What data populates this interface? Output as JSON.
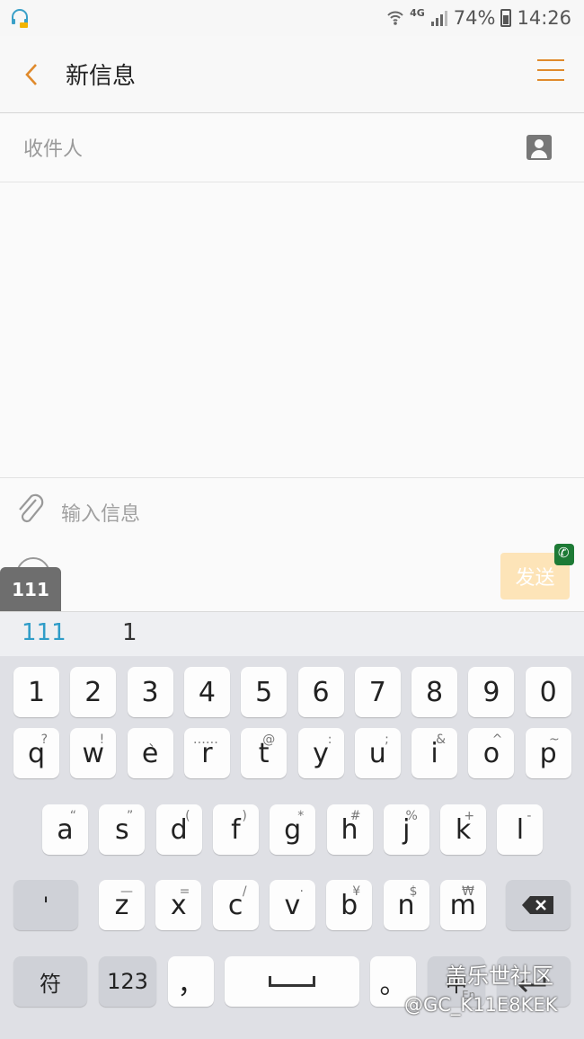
{
  "status_bar": {
    "network": "4G",
    "battery": "74%",
    "time": "14:26"
  },
  "header": {
    "title": "新信息"
  },
  "recipient": {
    "placeholder": "收件人"
  },
  "compose": {
    "placeholder": "输入信息",
    "send_label": "发送",
    "popup_text": "111"
  },
  "candidates": [
    "111",
    "1"
  ],
  "keyboard": {
    "row1": [
      "1",
      "2",
      "3",
      "4",
      "5",
      "6",
      "7",
      "8",
      "9",
      "0"
    ],
    "row2": [
      {
        "main": "q",
        "sub": "?"
      },
      {
        "main": "w",
        "sub": "!"
      },
      {
        "main": "e",
        "sub": "、"
      },
      {
        "main": "r",
        "sub": "……"
      },
      {
        "main": "t",
        "sub": "@"
      },
      {
        "main": "y",
        "sub": ":"
      },
      {
        "main": "u",
        "sub": ";"
      },
      {
        "main": "i",
        "sub": "&"
      },
      {
        "main": "o",
        "sub": "^"
      },
      {
        "main": "p",
        "sub": "~"
      }
    ],
    "row3": [
      {
        "main": "a",
        "sub": "“"
      },
      {
        "main": "s",
        "sub": "”"
      },
      {
        "main": "d",
        "sub": "("
      },
      {
        "main": "f",
        "sub": ")"
      },
      {
        "main": "g",
        "sub": "*"
      },
      {
        "main": "h",
        "sub": "#"
      },
      {
        "main": "j",
        "sub": "%"
      },
      {
        "main": "k",
        "sub": "+"
      },
      {
        "main": "l",
        "sub": "-"
      }
    ],
    "row4": [
      {
        "main": "z",
        "sub": "—"
      },
      {
        "main": "x",
        "sub": "="
      },
      {
        "main": "c",
        "sub": "/"
      },
      {
        "main": "v",
        "sub": "·"
      },
      {
        "main": "b",
        "sub": "¥"
      },
      {
        "main": "n",
        "sub": "$"
      },
      {
        "main": "m",
        "sub": "₩"
      }
    ],
    "apostrophe": "'",
    "symbols_label": "符",
    "numbers_label": "123",
    "comma_label": "，",
    "period_label": "。",
    "lang_label": "中",
    "lang_sub": "En"
  },
  "watermark": {
    "line1": "盖乐世社区",
    "line2": "@GC_K11E8KEK"
  }
}
